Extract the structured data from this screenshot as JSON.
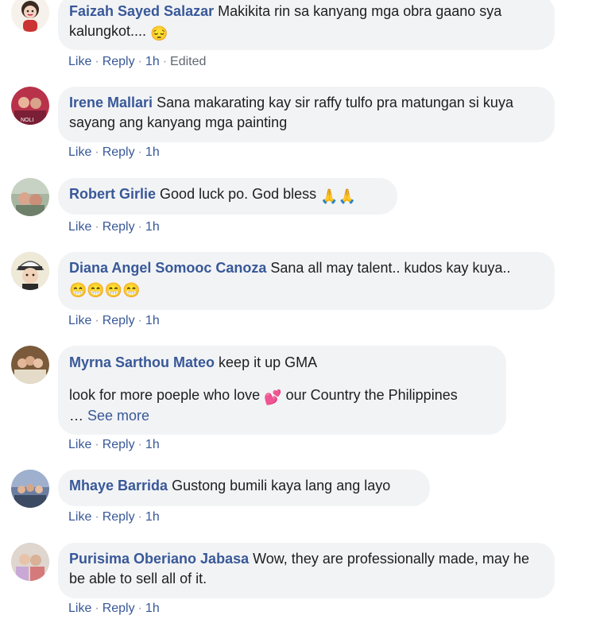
{
  "actions": {
    "like": "Like",
    "reply": "Reply",
    "sep": "·"
  },
  "comments": [
    {
      "author": "Faizah Sayed Salazar",
      "text": "Makikita rin sa kanyang mga obra gaano sya kalungkot....",
      "emoji": "😔",
      "time": "1h",
      "edited": "Edited"
    },
    {
      "author": "Irene Mallari",
      "text": "Sana makarating kay sir raffy tulfo pra matungan si kuya sayang ang kanyang mga painting",
      "time": "1h"
    },
    {
      "author": "Robert Girlie",
      "text": "Good luck po. God bless",
      "emoji": "🙏🙏",
      "time": "1h"
    },
    {
      "author": "Diana Angel Somooc Canoza",
      "text": "Sana all may talent.. kudos kay kuya..",
      "emoji": "😁😁😁😁",
      "time": "1h"
    },
    {
      "author": "Myrna Sarthou Mateo",
      "text": "keep it up GMA",
      "text2a": "look for more poeple who love",
      "emoji": "💕",
      "text2b": "our Country the Philippines",
      "ellipsis": "…",
      "see_more": "See more",
      "time": "1h"
    },
    {
      "author": "Mhaye Barrida",
      "text": "Gustong bumili kaya lang ang layo",
      "time": "1h"
    },
    {
      "author": "Purisima Oberiano Jabasa",
      "text": "Wow, they are professionally made, may he be able to sell all of it.",
      "time": "1h"
    }
  ]
}
